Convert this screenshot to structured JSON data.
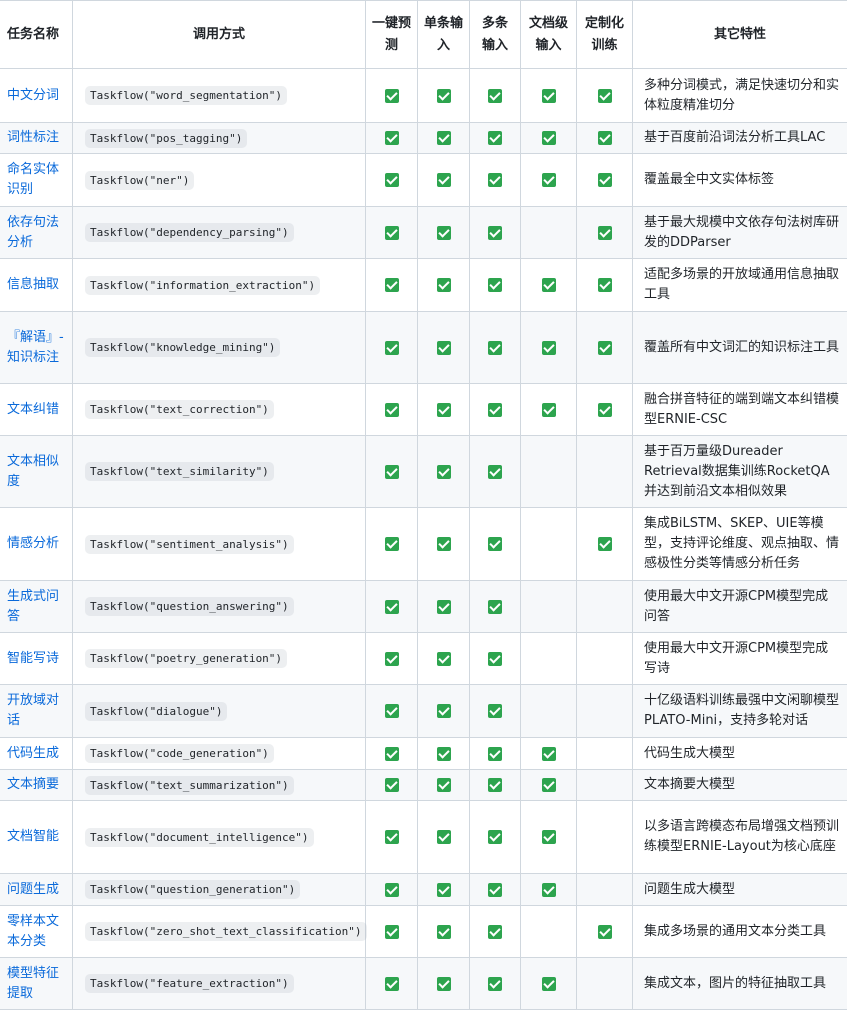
{
  "colors": {
    "link": "#0969da",
    "check": "#2da44e",
    "border": "#d0d7de",
    "stripe": "#f6f8fa"
  },
  "icons": {
    "check": "checkmark-icon"
  },
  "headers": {
    "name": "任务名称",
    "call": "调用方式",
    "onekey": "一键预测",
    "single": "单条输入",
    "multi": "多条输入",
    "doc": "文档级输入",
    "custom": "定制化训练",
    "feature": "其它特性"
  },
  "rows": [
    {
      "name": "中文分词",
      "call": "Taskflow(\"word_segmentation\")",
      "checks": [
        true,
        true,
        true,
        true,
        true
      ],
      "feature": "多种分词模式，满足快速切分和实体粒度精准切分",
      "h": 54
    },
    {
      "name": "词性标注",
      "call": "Taskflow(\"pos_tagging\")",
      "checks": [
        true,
        true,
        true,
        true,
        true
      ],
      "feature": "基于百度前沿词法分析工具LAC",
      "h": 31
    },
    {
      "name": "命名实体识别",
      "call": "Taskflow(\"ner\")",
      "checks": [
        true,
        true,
        true,
        true,
        true
      ],
      "feature": "覆盖最全中文实体标签",
      "h": 53
    },
    {
      "name": "依存句法分析",
      "call": "Taskflow(\"dependency_parsing\")",
      "checks": [
        true,
        true,
        true,
        false,
        true
      ],
      "feature": "基于最大规模中文依存句法树库研发的DDParser",
      "h": 52
    },
    {
      "name": "信息抽取",
      "call": "Taskflow(\"information_extraction\")",
      "checks": [
        true,
        true,
        true,
        true,
        true
      ],
      "feature": "适配多场景的开放域通用信息抽取工具",
      "h": 53
    },
    {
      "name": "『解语』-知识标注",
      "call": "Taskflow(\"knowledge_mining\")",
      "checks": [
        true,
        true,
        true,
        true,
        true
      ],
      "feature": "覆盖所有中文词汇的知识标注工具",
      "h": 72
    },
    {
      "name": "文本纠错",
      "call": "Taskflow(\"text_correction\")",
      "checks": [
        true,
        true,
        true,
        true,
        true
      ],
      "feature": "融合拼音特征的端到端文本纠错模型ERNIE-CSC",
      "h": 52
    },
    {
      "name": "文本相似度",
      "call": "Taskflow(\"text_similarity\")",
      "checks": [
        true,
        true,
        true,
        false,
        false
      ],
      "feature": "基于百万量级Dureader Retrieval数据集训练RocketQA并达到前沿文本相似效果",
      "h": 72
    },
    {
      "name": "情感分析",
      "call": "Taskflow(\"sentiment_analysis\")",
      "checks": [
        true,
        true,
        true,
        false,
        true
      ],
      "feature": "集成BiLSTM、SKEP、UIE等模型，支持评论维度、观点抽取、情感极性分类等情感分析任务",
      "h": 73
    },
    {
      "name": "生成式问答",
      "call": "Taskflow(\"question_answering\")",
      "checks": [
        true,
        true,
        true,
        false,
        false
      ],
      "feature": "使用最大中文开源CPM模型完成问答",
      "h": 52
    },
    {
      "name": "智能写诗",
      "call": "Taskflow(\"poetry_generation\")",
      "checks": [
        true,
        true,
        true,
        false,
        false
      ],
      "feature": "使用最大中文开源CPM模型完成写诗",
      "h": 52
    },
    {
      "name": "开放域对话",
      "call": "Taskflow(\"dialogue\")",
      "checks": [
        true,
        true,
        true,
        false,
        false
      ],
      "feature": "十亿级语料训练最强中文闲聊模型PLATO-Mini，支持多轮对话",
      "h": 53
    },
    {
      "name": "代码生成",
      "call": "Taskflow(\"code_generation\")",
      "checks": [
        true,
        true,
        true,
        true,
        false
      ],
      "feature": "代码生成大模型",
      "h": 32
    },
    {
      "name": "文本摘要",
      "call": "Taskflow(\"text_summarization\")",
      "checks": [
        true,
        true,
        true,
        true,
        false
      ],
      "feature": "文本摘要大模型",
      "h": 31
    },
    {
      "name": "文档智能",
      "call": "Taskflow(\"document_intelligence\")",
      "checks": [
        true,
        true,
        true,
        true,
        false
      ],
      "feature": "以多语言跨模态布局增强文档预训练模型ERNIE-Layout为核心底座",
      "h": 73
    },
    {
      "name": "问题生成",
      "call": "Taskflow(\"question_generation\")",
      "checks": [
        true,
        true,
        true,
        true,
        false
      ],
      "feature": "问题生成大模型",
      "h": 32
    },
    {
      "name": "零样本文本分类",
      "call": "Taskflow(\"zero_shot_text_classification\")",
      "checks": [
        true,
        true,
        true,
        false,
        true
      ],
      "feature": "集成多场景的通用文本分类工具",
      "h": 52
    },
    {
      "name": "模型特征提取",
      "call": "Taskflow(\"feature_extraction\")",
      "checks": [
        true,
        true,
        true,
        true,
        false
      ],
      "feature": "集成文本，图片的特征抽取工具",
      "h": 52
    }
  ]
}
